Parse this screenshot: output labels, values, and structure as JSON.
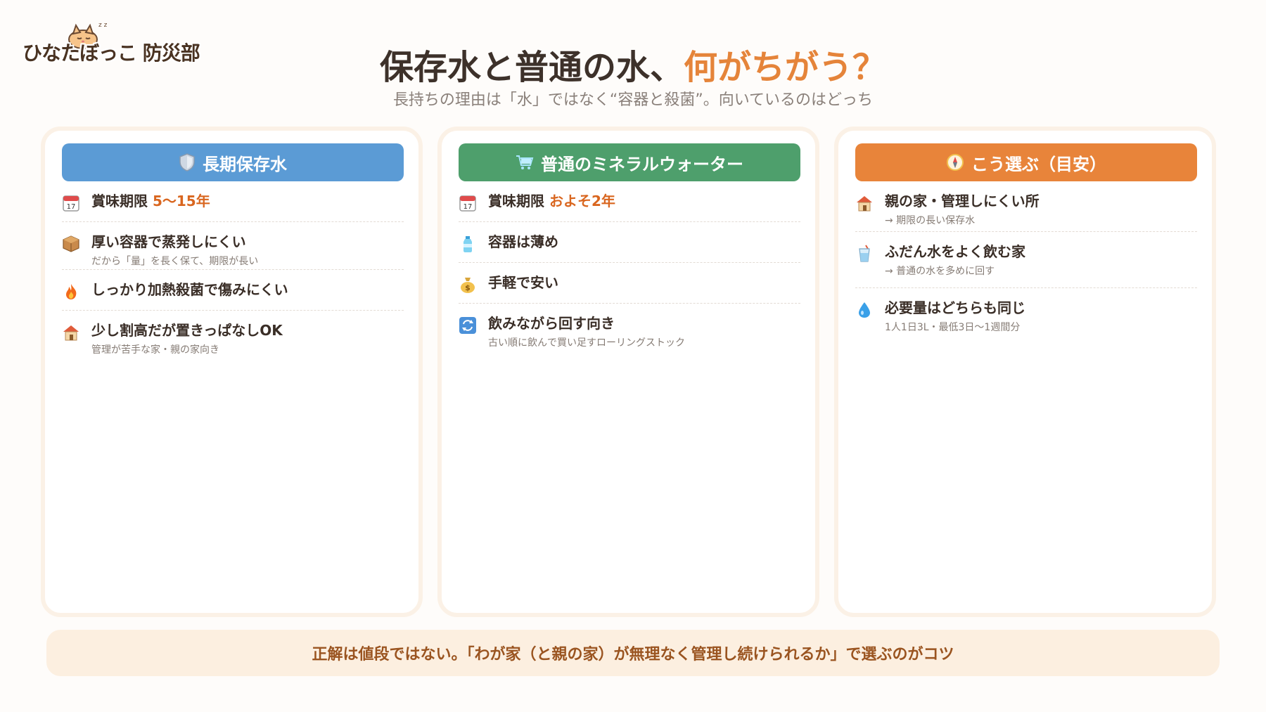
{
  "logo": {
    "text": "ひなたぼっこ 防災部",
    "zz": "z z"
  },
  "title": {
    "main": "保存水と普通の水、",
    "accent": "何がちがう？"
  },
  "subtitle": "長持ちの理由は「水」ではなく“容器と殺菌”。向いているのはどっち",
  "columns": [
    {
      "header": "長期保存水",
      "header_icon": "shield-icon",
      "color": "#5b9bd5",
      "items": [
        {
          "icon": "calendar-icon",
          "main": "賞味期限 ",
          "highlight": "5〜15年",
          "sub": ""
        },
        {
          "icon": "package-icon",
          "main": "厚い容器で蒸発しにくい",
          "sub": "だから「量」を長く保て、期限が長い"
        },
        {
          "icon": "fire-icon",
          "main": "しっかり加熱殺菌で傷みにくい",
          "sub": ""
        },
        {
          "icon": "house-icon",
          "main": "少し割高だが置きっぱなしOK",
          "sub": "管理が苦手な家・親の家向き"
        }
      ]
    },
    {
      "header": "普通のミネラルウォーター",
      "header_icon": "cart-icon",
      "color": "#4e9f6c",
      "items": [
        {
          "icon": "calendar-icon",
          "main": "賞味期限 ",
          "highlight": "およそ2年",
          "sub": ""
        },
        {
          "icon": "bottle-icon",
          "main": "容器は薄め",
          "sub": ""
        },
        {
          "icon": "money-bag-icon",
          "main": "手軽で安い",
          "sub": ""
        },
        {
          "icon": "rotate-icon",
          "main": "飲みながら回す向き",
          "sub": "古い順に飲んで買い足すローリングストック"
        }
      ]
    },
    {
      "header": "こう選ぶ（目安）",
      "header_icon": "compass-icon",
      "color": "#e8843a",
      "items": [
        {
          "icon": "house-icon",
          "main": "親の家・管理しにくい所",
          "sub": "→ 期限の長い保存水"
        },
        {
          "icon": "cup-icon",
          "main": "ふだん水をよく飲む家",
          "sub": "→ 普通の水を多めに回す"
        },
        {
          "icon": "droplet-icon",
          "main": "必要量はどちらも同じ",
          "sub": "1人1日3L・最低3日〜1週間分"
        }
      ]
    }
  ],
  "bottom_note": "正解は値段ではない。「わが家（と親の家）が無理なく管理し続けられるか」で選ぶのがコツ"
}
